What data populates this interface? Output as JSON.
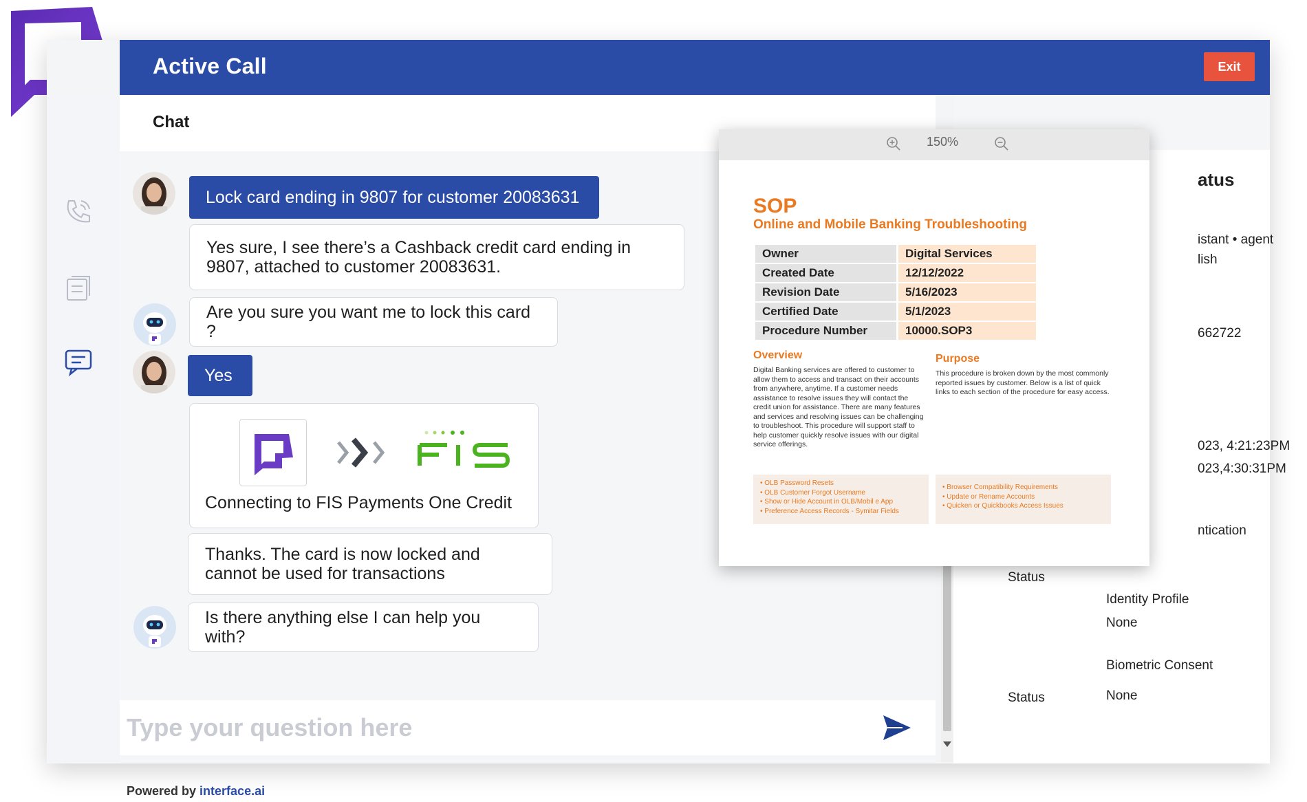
{
  "header": {
    "title": "Active Call",
    "exit_label": "Exit"
  },
  "chat": {
    "label": "Chat",
    "messages": [
      {
        "from": "user",
        "text": "Lock card ending in 9807 for customer 20083631"
      },
      {
        "from": "bot",
        "text": "Yes sure, I see there’s a Cashback credit card ending in 9807, attached to customer 20083631."
      },
      {
        "from": "bot",
        "text": "Are you sure you want me to lock this card ?"
      },
      {
        "from": "user",
        "text": "Yes"
      },
      {
        "from": "bot",
        "text": "Connecting to FIS Payments One Credit"
      },
      {
        "from": "bot",
        "text": "Thanks. The card is now locked and cannot be used for transactions"
      },
      {
        "from": "bot",
        "text": "Is there anything else I can help you with?"
      }
    ],
    "composer_placeholder": "Type your question here",
    "powered_prefix": "Powered by",
    "powered_brand": "interface.ai"
  },
  "sop": {
    "zoom": "150%",
    "title": "SOP",
    "subtitle": "Online and Mobile Banking Troubleshooting",
    "meta": [
      {
        "key": "Owner",
        "value": "Digital Services"
      },
      {
        "key": "Created Date",
        "value": "12/12/2022"
      },
      {
        "key": "Revision Date",
        "value": "5/16/2023"
      },
      {
        "key": "Certified Date",
        "value": "5/1/2023"
      },
      {
        "key": "Procedure Number",
        "value": "10000.SOP3"
      }
    ],
    "overview_title": "Overview",
    "overview_body": "Digital Banking services are offered to customer to allow them to access and transact on their accounts from anywhere, anytime. If a customer needs assistance to resolve issues they will contact the credit union for assistance. There are many features and services and resolving issues can be challenging to troubleshoot. This procedure will support staff to help customer quickly resolve issues with our digital service offerings.",
    "purpose_title": "Purpose",
    "purpose_body": "This procedure is broken down by the most commonly reported issues by customer. Below is a list of quick links to each section of the procedure for easy access.",
    "links_left": [
      "• OLB Password Resets",
      "• OLB Customer Forgot Username",
      "• Show or Hide Account in OLB/Mobil e App",
      "• Preference Access Records - Symitar Fields"
    ],
    "links_right": [
      "• Browser Compatibility Requirements",
      "• Update or Rename Accounts",
      "• Quicken or Quickbooks Access Issues"
    ]
  },
  "status_panel": {
    "heading_fragment": "atus",
    "line1": "istant • agent",
    "line2": "lish",
    "id_fragment": "662722",
    "time1": "023, 4:21:23PM",
    "time2": "023,4:30:31PM",
    "auth_fragment": "ntication",
    "status_label_1": "Status",
    "identity_profile_label": "Identity Profile",
    "identity_profile_value": "None",
    "biometric_label": "Biometric Consent",
    "status_label_2": "Status",
    "biometric_value": "None"
  }
}
